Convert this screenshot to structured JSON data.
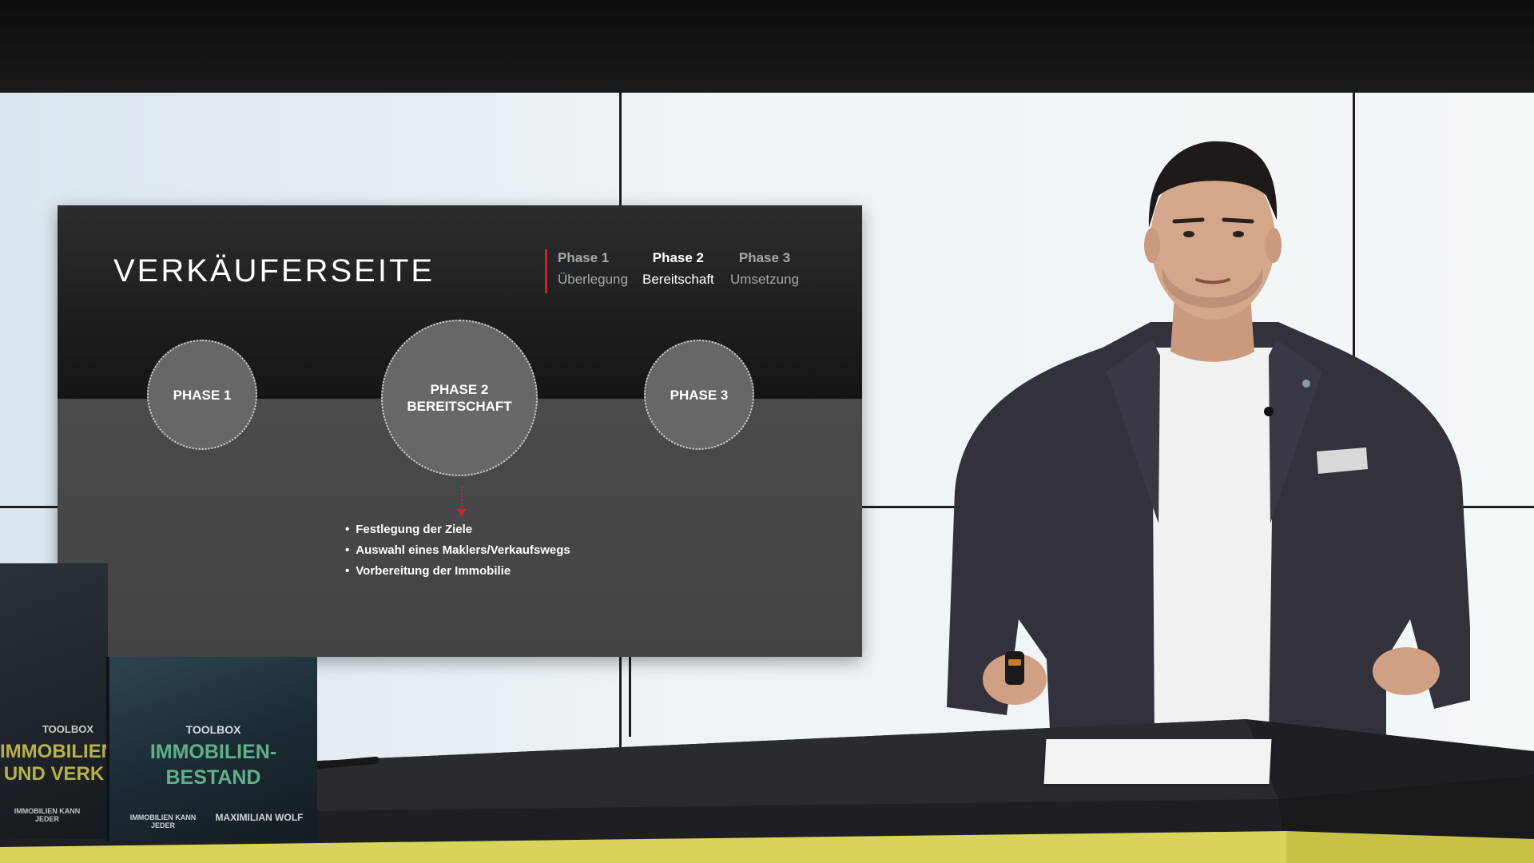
{
  "slide": {
    "title": "VERKÄUFERSEITE",
    "tracker": [
      {
        "number": "Phase 1",
        "label": "Überlegung",
        "active": false
      },
      {
        "number": "Phase 2",
        "label": "Bereitschaft",
        "active": true
      },
      {
        "number": "Phase 3",
        "label": "Umsetzung",
        "active": false
      }
    ],
    "phases": [
      {
        "line1": "PHASE 1",
        "line2": ""
      },
      {
        "line1": "PHASE 2",
        "line2": "BEREITSCHAFT"
      },
      {
        "line1": "PHASE 3",
        "line2": ""
      }
    ],
    "bullets": [
      "Festlegung der Ziele",
      "Auswahl eines Maklers/Verkaufswegs",
      "Vorbereitung der Immobilie"
    ],
    "colors": {
      "accent": "#d61f26",
      "circle": "#676769"
    }
  },
  "books": [
    {
      "series": "TOOLBOX",
      "title": "IMMOBILIEN UND VERK",
      "brand": "IMMOBILIEN KANN JEDER"
    },
    {
      "series": "TOOLBOX",
      "title": "IMMOBILIEN- BESTAND",
      "brand": "IMMOBILIEN KANN JEDER",
      "author": "MAXIMILIAN WOLF"
    }
  ]
}
